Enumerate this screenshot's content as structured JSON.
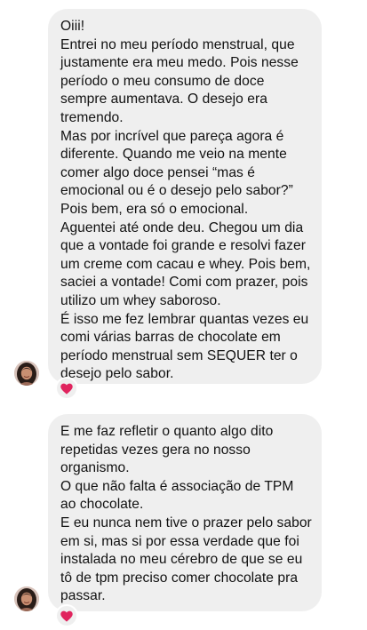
{
  "messages": [
    {
      "lines": [
        "Oiii!",
        "Entrei no meu período menstrual, que justamente era meu medo. Pois nesse período o meu consumo de doce sempre aumentava. O desejo era tremendo.",
        "Mas por incrível que pareça agora é diferente. Quando me veio na mente comer algo doce pensei “mas é emocional ou é o desejo pelo sabor?” Pois bem, era só o emocional.",
        "Aguentei até onde deu. Chegou um dia que a vontade foi grande e resolvi fazer um creme com cacau e whey. Pois bem, saciei a vontade! Comi com prazer, pois utilizo um whey saboroso.",
        "É isso me fez lembrar quantas vezes eu comi várias barras de chocolate em período menstrual sem SEQUER ter o desejo pelo sabor."
      ],
      "reaction": "heart-icon"
    },
    {
      "lines": [
        "E me faz refletir o quanto algo dito repetidas vezes gera no nosso organismo.",
        "O que não falta é associação de TPM ao chocolate.",
        "E eu nunca nem tive o prazer pelo sabor em si, mas si por essa verdade que foi instalada no meu cérebro de que se eu tô de tpm preciso comer chocolate pra passar."
      ],
      "reaction": "heart-icon"
    }
  ],
  "colors": {
    "bubble": "#efefef",
    "text": "#111111",
    "heart": "#e0245e"
  }
}
